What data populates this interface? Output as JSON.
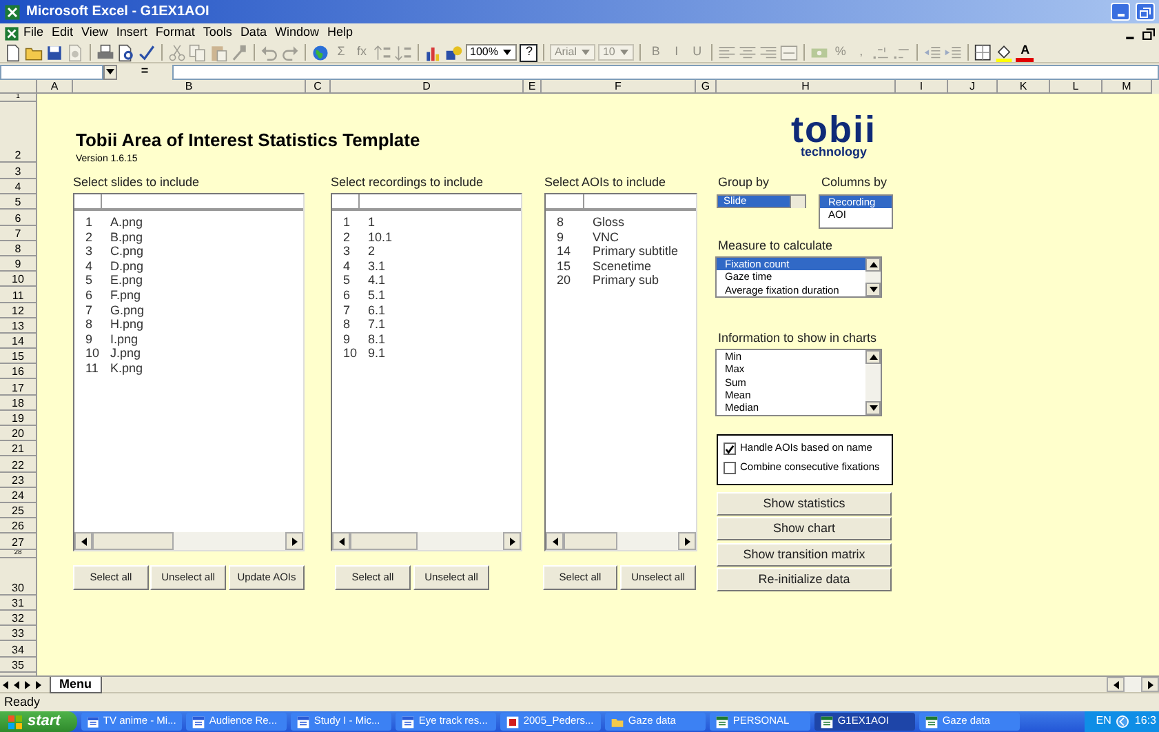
{
  "window": {
    "title": "Microsoft Excel - G1EX1AOI"
  },
  "menu_bar": [
    "File",
    "Edit",
    "View",
    "Insert",
    "Format",
    "Tools",
    "Data",
    "Window",
    "Help"
  ],
  "toolbar": [
    {
      "kind": "page",
      "disabled": false
    },
    {
      "kind": "folder",
      "disabled": false
    },
    {
      "kind": "disk",
      "disabled": false
    },
    {
      "kind": "permission",
      "disabled": true
    },
    {
      "kind": "separator"
    },
    {
      "kind": "printer",
      "disabled": false
    },
    {
      "kind": "preview",
      "disabled": false
    },
    {
      "kind": "spelling",
      "disabled": false
    },
    {
      "kind": "separator"
    },
    {
      "kind": "cut",
      "disabled": true
    },
    {
      "kind": "copy",
      "disabled": true
    },
    {
      "kind": "paste",
      "disabled": true
    },
    {
      "kind": "brush",
      "disabled": true
    },
    {
      "kind": "separator"
    },
    {
      "kind": "undo",
      "disabled": true
    },
    {
      "kind": "redo",
      "disabled": true
    },
    {
      "kind": "separator"
    },
    {
      "kind": "globe",
      "disabled": false
    },
    {
      "kind": "glyph",
      "text": "Σ",
      "disabled": true
    },
    {
      "kind": "glyph",
      "text": "fx",
      "disabled": true
    },
    {
      "kind": "sortup",
      "disabled": true
    },
    {
      "kind": "sortdown",
      "disabled": true
    },
    {
      "kind": "separator"
    },
    {
      "kind": "chart",
      "disabled": false
    },
    {
      "kind": "drawing",
      "disabled": false
    },
    {
      "kind": "combo",
      "text": "100%",
      "disabled": false
    },
    {
      "kind": "help",
      "text": "?",
      "disabled": false
    },
    {
      "kind": "separator"
    },
    {
      "kind": "combo",
      "text": "Arial",
      "disabled": true
    },
    {
      "kind": "combo",
      "text": "10",
      "disabled": true
    },
    {
      "kind": "separator"
    },
    {
      "kind": "glyph",
      "text": "B",
      "disabled": true
    },
    {
      "kind": "glyph",
      "text": "I",
      "disabled": true
    },
    {
      "kind": "glyph",
      "text": "U",
      "disabled": true
    },
    {
      "kind": "separator"
    },
    {
      "kind": "alignleft",
      "disabled": true
    },
    {
      "kind": "aligncenter",
      "disabled": true
    },
    {
      "kind": "alignright",
      "disabled": true
    },
    {
      "kind": "merge",
      "disabled": true
    },
    {
      "kind": "separator"
    },
    {
      "kind": "currency",
      "disabled": true
    },
    {
      "kind": "glyph",
      "text": "%",
      "disabled": true
    },
    {
      "kind": "glyph",
      "text": ",",
      "disabled": true
    },
    {
      "kind": "decimalmore",
      "disabled": true
    },
    {
      "kind": "decimalless",
      "disabled": true
    },
    {
      "kind": "separator"
    },
    {
      "kind": "indentless",
      "disabled": true
    },
    {
      "kind": "indentmore",
      "disabled": true
    },
    {
      "kind": "separator"
    },
    {
      "kind": "borders",
      "disabled": false
    },
    {
      "kind": "fill",
      "disabled": false
    },
    {
      "kind": "fontcolor",
      "text": "A",
      "disabled": false
    }
  ],
  "formula_bar": {
    "equals": "="
  },
  "column_headers": [
    "A",
    "B",
    "C",
    "D",
    "E",
    "F",
    "G",
    "H",
    "I",
    "J",
    "K",
    "L",
    "M"
  ],
  "row_headers": [
    "1",
    "2",
    "3",
    "4",
    "5",
    "6",
    "7",
    "8",
    "9",
    "10",
    "11",
    "12",
    "13",
    "14",
    "15",
    "16",
    "17",
    "18",
    "19",
    "20",
    "21",
    "22",
    "23",
    "24",
    "25",
    "26",
    "27",
    "28",
    "30",
    "31",
    "32",
    "33",
    "34",
    "35"
  ],
  "sheet": {
    "title": "Tobii Area of Interest Statistics Template",
    "version": "Version 1.6.15",
    "logo": {
      "name": "tobii",
      "tagline": "technology"
    },
    "lists": [
      {
        "label": "Select slides to include",
        "items": [
          {
            "num": "1",
            "text": "A.png"
          },
          {
            "num": "2",
            "text": "B.png"
          },
          {
            "num": "3",
            "text": "C.png"
          },
          {
            "num": "4",
            "text": "D.png"
          },
          {
            "num": "5",
            "text": "E.png"
          },
          {
            "num": "6",
            "text": "F.png"
          },
          {
            "num": "7",
            "text": "G.png"
          },
          {
            "num": "8",
            "text": "H.png"
          },
          {
            "num": "9",
            "text": "I.png"
          },
          {
            "num": "10",
            "text": "J.png"
          },
          {
            "num": "11",
            "text": "K.png"
          }
        ],
        "buttons": [
          "Select all",
          "Unselect all",
          "Update AOIs"
        ]
      },
      {
        "label": "Select recordings to include",
        "items": [
          {
            "num": "1",
            "text": "1"
          },
          {
            "num": "2",
            "text": "10.1"
          },
          {
            "num": "3",
            "text": "2"
          },
          {
            "num": "4",
            "text": "3.1"
          },
          {
            "num": "5",
            "text": "4.1"
          },
          {
            "num": "6",
            "text": "5.1"
          },
          {
            "num": "7",
            "text": "6.1"
          },
          {
            "num": "8",
            "text": "7.1"
          },
          {
            "num": "9",
            "text": "8.1"
          },
          {
            "num": "10",
            "text": "9.1"
          }
        ],
        "buttons": [
          "Select all",
          "Unselect all"
        ]
      },
      {
        "label": "Select AOIs to include",
        "items": [
          {
            "num": "8",
            "text": "Gloss"
          },
          {
            "num": "9",
            "text": "VNC"
          },
          {
            "num": "14",
            "text": "Primary subtitle"
          },
          {
            "num": "15",
            "text": "Scenetime"
          },
          {
            "num": "20",
            "text": "Primary sub"
          }
        ],
        "buttons": [
          "Select all",
          "Unselect all"
        ]
      }
    ],
    "group_by": {
      "label": "Group by",
      "value": "Slide"
    },
    "columns_by": {
      "label": "Columns by",
      "options": [
        {
          "text": "Recording",
          "selected": true
        },
        {
          "text": "AOI",
          "selected": false
        }
      ]
    },
    "measure": {
      "label": "Measure to calculate",
      "options": [
        {
          "text": "Fixation count",
          "selected": true
        },
        {
          "text": "Gaze time",
          "selected": false
        },
        {
          "text": "Average fixation duration",
          "selected": false
        }
      ]
    },
    "chart_info": {
      "label": "Information to show in charts",
      "options": [
        {
          "text": "Min",
          "selected": false
        },
        {
          "text": "Max",
          "selected": false
        },
        {
          "text": "Sum",
          "selected": false
        },
        {
          "text": "Mean",
          "selected": false
        },
        {
          "text": "Median",
          "selected": false
        }
      ]
    },
    "checkboxes": [
      {
        "label": "Handle AOIs based on name",
        "checked": true
      },
      {
        "label": "Combine consecutive fixations",
        "checked": false
      }
    ],
    "actions": [
      "Show statistics",
      "Show chart",
      "Show transition matrix",
      "Re-initialize data"
    ]
  },
  "sheet_tabs": [
    {
      "label": "Menu",
      "selected": true
    }
  ],
  "status_bar": {
    "text": "Ready"
  },
  "taskbar": {
    "start": "start",
    "tasks": [
      {
        "label": "TV anime - Mi...",
        "kind": "word",
        "selected": false
      },
      {
        "label": "Audience Re...",
        "kind": "word",
        "selected": false
      },
      {
        "label": "Study I - Mic...",
        "kind": "word",
        "selected": false
      },
      {
        "label": "Eye track res...",
        "kind": "word",
        "selected": false
      },
      {
        "label": "2005_Peders...",
        "kind": "pdf",
        "selected": false
      },
      {
        "label": "Gaze data",
        "kind": "folder",
        "selected": false
      },
      {
        "label": "PERSONAL",
        "kind": "excel",
        "selected": false
      },
      {
        "label": "G1EX1AOI",
        "kind": "excel",
        "selected": true
      },
      {
        "label": "Gaze data",
        "kind": "excel",
        "selected": false
      }
    ],
    "language": "EN",
    "clock": "16:3"
  }
}
